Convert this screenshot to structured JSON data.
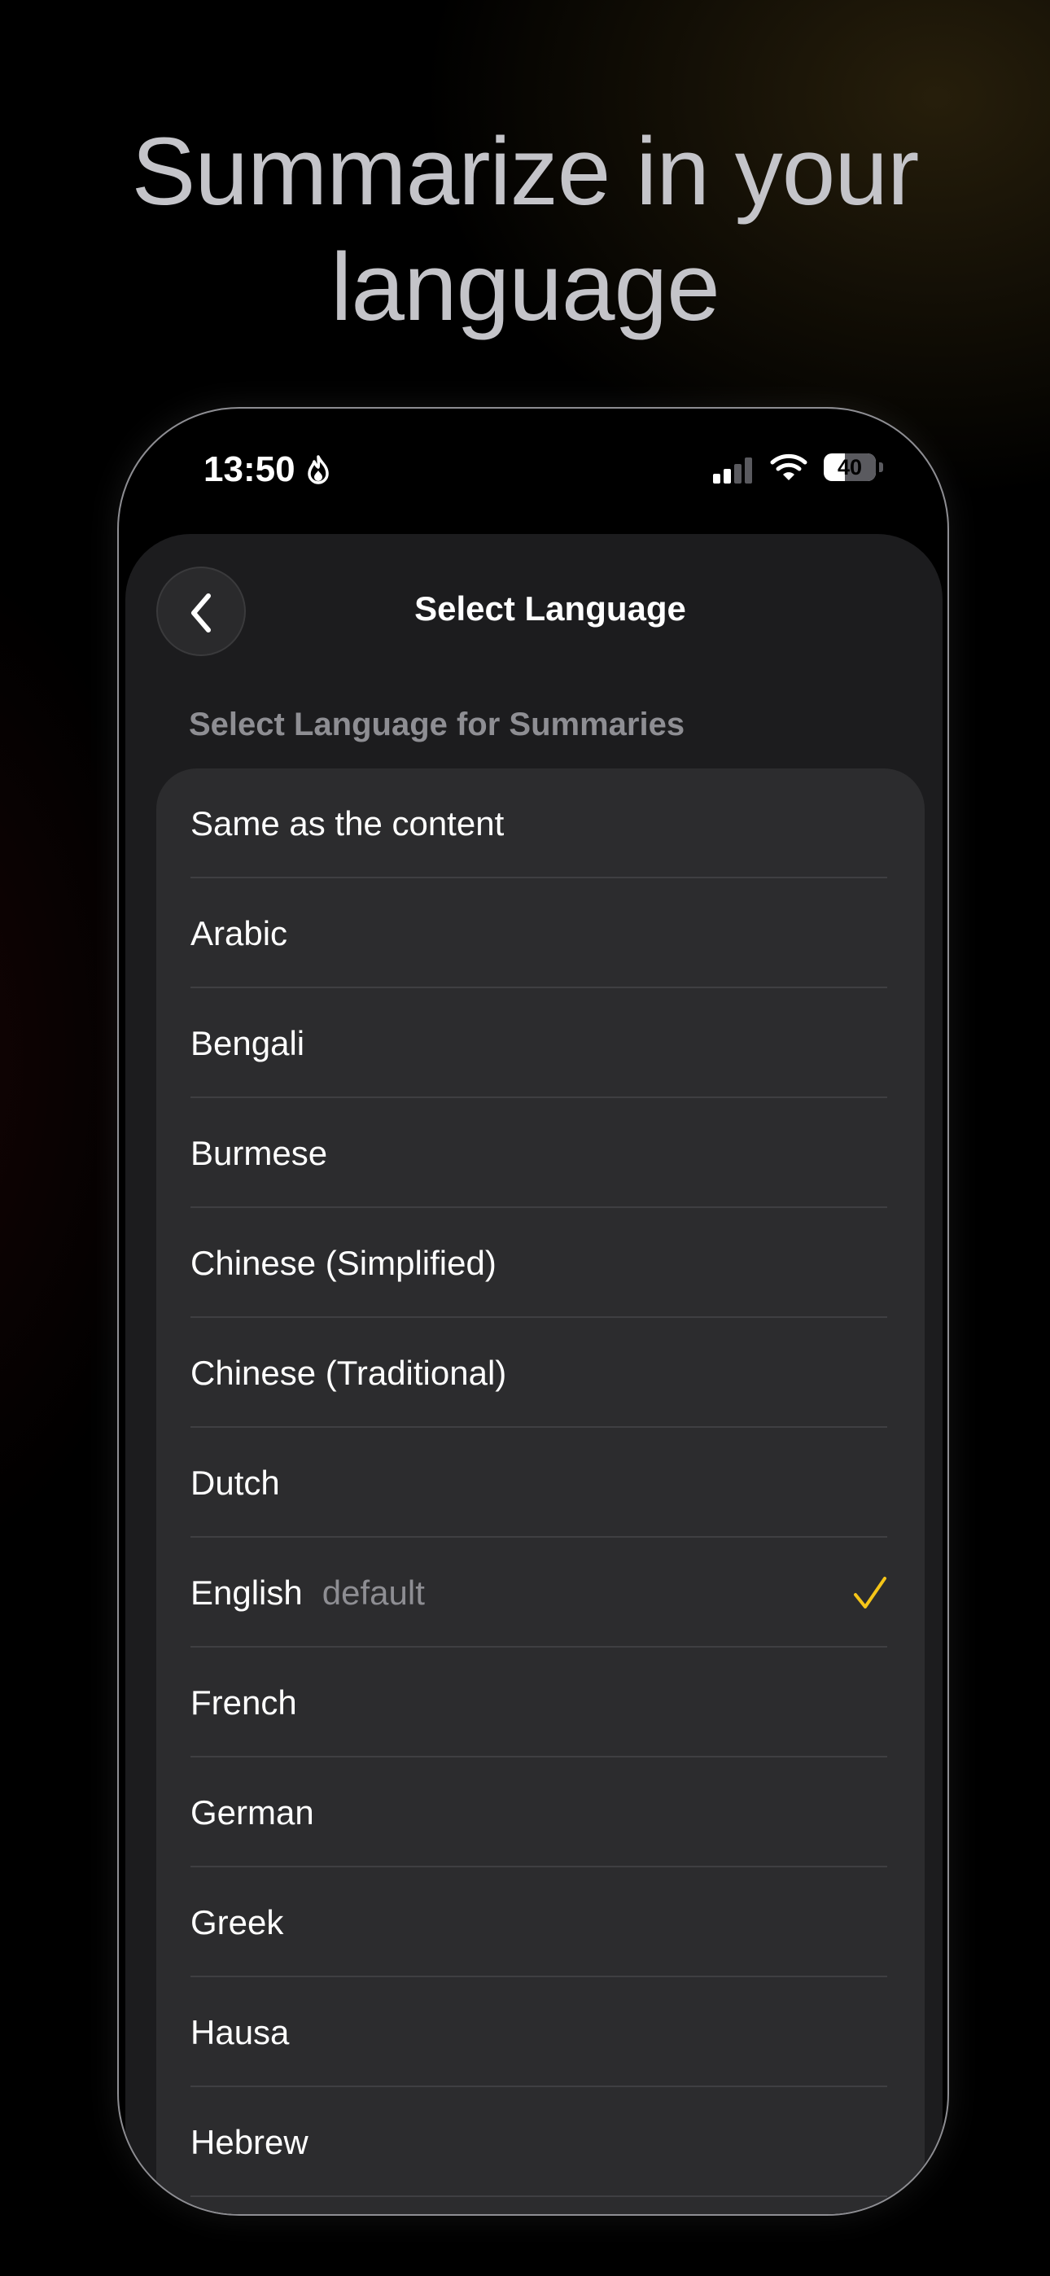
{
  "headline": {
    "line1": "Summarize in your",
    "line2": "language"
  },
  "status_bar": {
    "time": "13:50",
    "battery": "40",
    "icons": [
      "flame-icon",
      "signal-icon",
      "wifi-icon",
      "battery-icon"
    ]
  },
  "nav": {
    "title": "Select Language",
    "back_icon": "chevron-left-icon"
  },
  "section_header": "Select Language for Summaries",
  "colors": {
    "accent_check": "#f5c518",
    "background": "#000000",
    "sheet": "#1c1c1e",
    "list": "#2c2c2e"
  },
  "languages": [
    {
      "label": "Same as the content"
    },
    {
      "label": "Arabic"
    },
    {
      "label": "Bengali"
    },
    {
      "label": "Burmese"
    },
    {
      "label": "Chinese (Simplified)"
    },
    {
      "label": "Chinese (Traditional)"
    },
    {
      "label": "Dutch"
    },
    {
      "label": "English",
      "sub": "default",
      "selected": true
    },
    {
      "label": "French"
    },
    {
      "label": "German"
    },
    {
      "label": "Greek"
    },
    {
      "label": "Hausa"
    },
    {
      "label": "Hebrew"
    }
  ]
}
